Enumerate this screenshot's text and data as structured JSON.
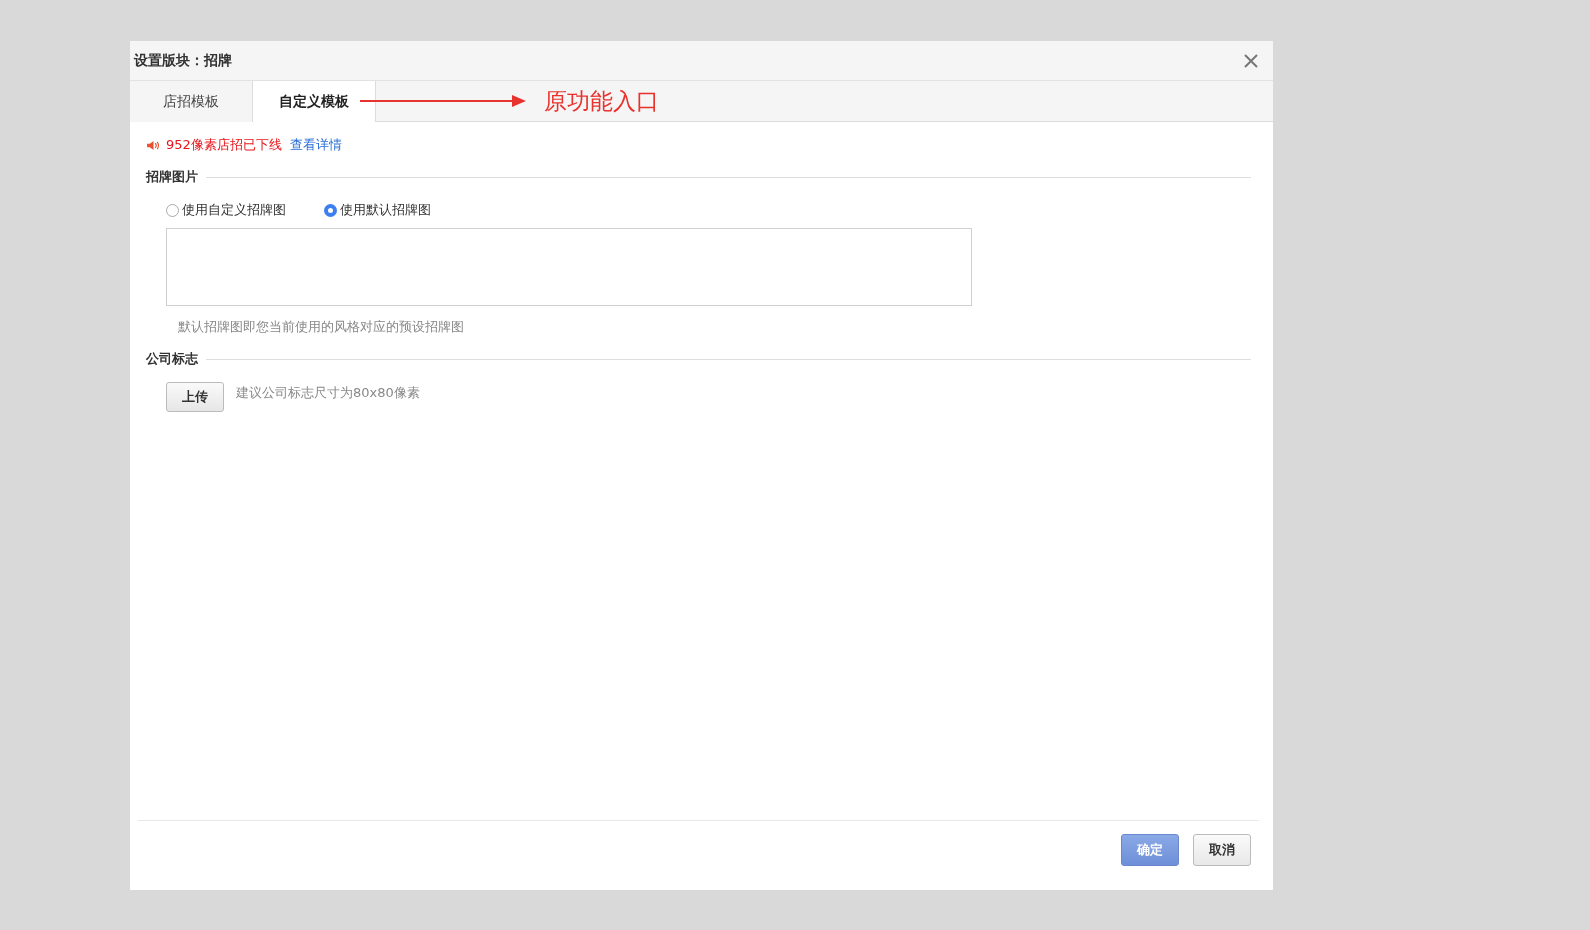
{
  "dialog": {
    "title": "设置版块：招牌",
    "tabs": [
      {
        "label": "店招模板",
        "selected": false
      },
      {
        "label": "自定义模板",
        "selected": true
      }
    ],
    "annotation": {
      "text": "原功能入口"
    },
    "notice": {
      "text": "952像素店招已下线",
      "link": "查看详情"
    },
    "sections": [
      {
        "title": "招牌图片",
        "options": [
          {
            "label": "使用自定义招牌图",
            "selected": false
          },
          {
            "label": "使用默认招牌图",
            "selected": true
          }
        ],
        "hint": "默认招牌图即您当前使用的风格对应的预设招牌图"
      },
      {
        "title": "公司标志",
        "button": "上传",
        "hint": "建议公司标志尺寸为80x80像素"
      }
    ],
    "buttons": [
      {
        "label": "确定",
        "kind": "primary"
      },
      {
        "label": "取消",
        "kind": "secondary"
      }
    ]
  }
}
